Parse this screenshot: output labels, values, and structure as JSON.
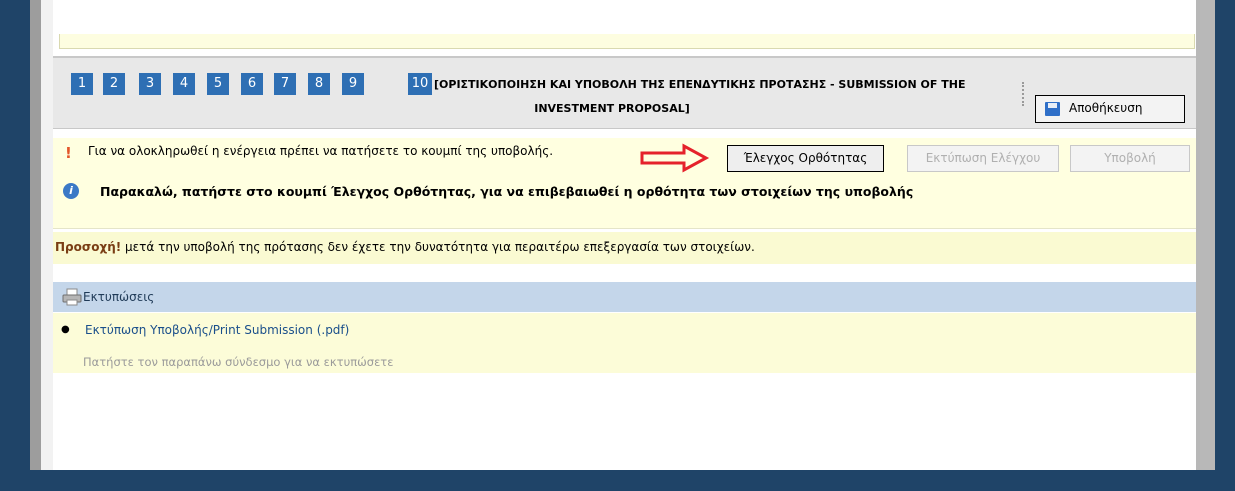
{
  "steps": [
    "1",
    "2",
    "3",
    "4",
    "5",
    "6",
    "7",
    "8",
    "9",
    "10"
  ],
  "step_title": {
    "line1": "[ΟΡΙΣΤΙΚΟΠΟΙΗΣΗ ΚΑΙ ΥΠΟΒΟΛΗ ΤΗΣ ΕΠΕΝΔΥΤΙΚΗΣ ΠΡΟΤΑΣΗΣ - SUBMISSION OF THE",
    "line2": "INVESTMENT PROPOSAL]"
  },
  "toolbar": {
    "save_label": "Αποθήκευση"
  },
  "notice": {
    "warning_text": "Για να ολοκληρωθεί η ενέργεια πρέπει να πατήσετε το κουμπί της υποβολής.",
    "buttons": {
      "check_label": "Έλεγχος Ορθότητας",
      "print_check_label": "Εκτύπωση Ελέγχου",
      "submit_label": "Υποβολή"
    },
    "info_text": "Παρακαλώ, πατήστε στο κουμπί Έλεγχος Ορθότητας, για να επιβεβαιωθεί η ορθότητα των στοιχείων της υποβολής"
  },
  "attention": {
    "label": "Προσοχή!",
    "text": " μετά την υποβολή της πρότασης δεν έχετε την δυνατότητα για περαιτέρω επεξεργασία των στοιχείων."
  },
  "prints": {
    "header": "Εκτυπώσεις",
    "link": "Εκτύπωση Υποβολής/Print Submission (.pdf)",
    "hint": "Πατήστε τον παραπάνω σύνδεσμο για να εκτυπώσετε"
  },
  "colors": {
    "frame": "#1f4468",
    "step_button": "#2e6fb4",
    "arrow": "#e5222b",
    "notice_bg": "#ffffe0",
    "print_header_bg": "#c4d6ea"
  }
}
